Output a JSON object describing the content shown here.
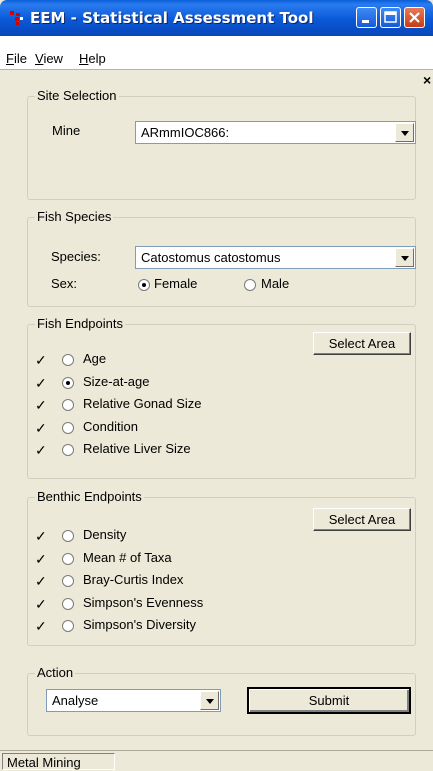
{
  "window": {
    "title": "EEM - Statistical Assessment Tool"
  },
  "menu": [
    {
      "label": "File",
      "accel": "F"
    },
    {
      "label": "View",
      "accel": "V"
    },
    {
      "label": "Help",
      "accel": "H"
    }
  ],
  "pane_close": "×",
  "site_selection": {
    "legend": "Site Selection",
    "mine_label": "Mine",
    "mine_value": "ARmmIOC866:"
  },
  "fish_species": {
    "legend": "Fish Species",
    "species_label": "Species:",
    "species_value": "Catostomus catostomus",
    "sex_label": "Sex:",
    "sex_options": [
      "Female",
      "Male"
    ],
    "sex_selected": 0
  },
  "fish_endpoints": {
    "legend": "Fish Endpoints",
    "select_area": "Select Area",
    "items": [
      "Age",
      "Size-at-age",
      "Relative Gonad Size",
      "Condition",
      "Relative Liver Size"
    ],
    "selected": 1
  },
  "benthic_endpoints": {
    "legend": "Benthic Endpoints",
    "select_area": "Select Area",
    "items": [
      "Density",
      "Mean # of Taxa",
      "Bray-Curtis Index",
      "Simpson's Evenness",
      "Simpson's Diversity"
    ],
    "selected": -1
  },
  "action": {
    "legend": "Action",
    "value": "Analyse",
    "submit": "Submit"
  },
  "check_mark": "✓",
  "status": {
    "text": "Metal Mining"
  },
  "colors": {
    "titlebar": "#0a58d8",
    "background": "#ece9d8",
    "close_button": "#c93c12"
  }
}
